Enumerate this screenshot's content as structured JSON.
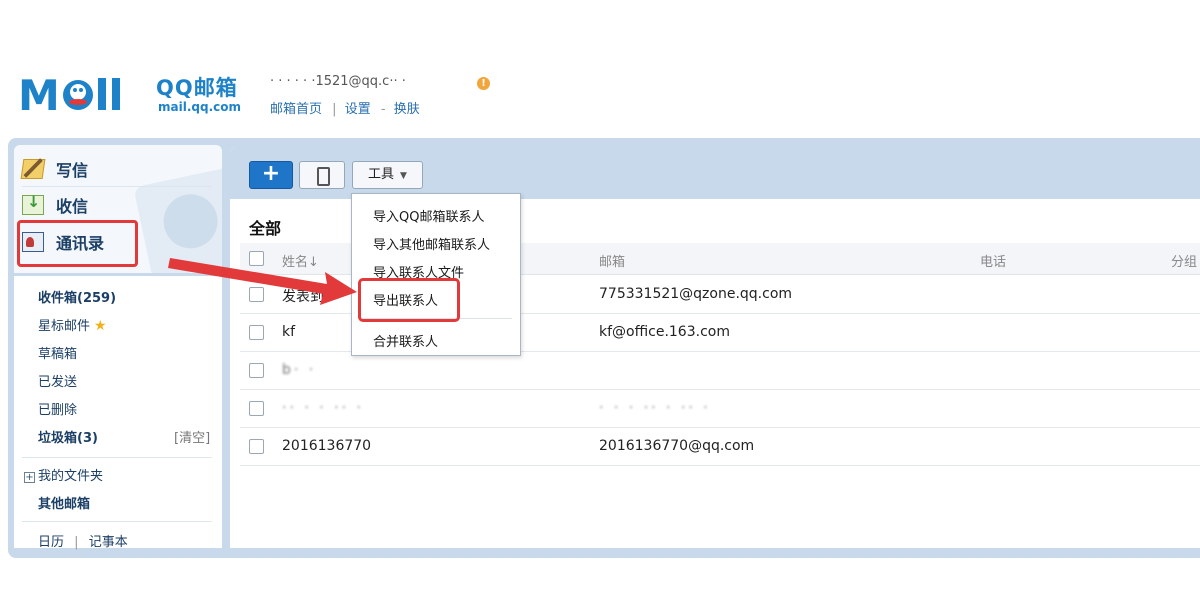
{
  "brand": {
    "logo_text": "MOil",
    "product_name": "QQ邮箱",
    "domain": "mail.qq.com"
  },
  "account": {
    "email_partial": "· ·  ·   · · ·1521@qq.c·· ·",
    "warning_icon": "warning-dot-icon"
  },
  "header_links": {
    "home": "邮箱首页",
    "separator": "|",
    "settings": "设置",
    "dash": "-",
    "skin": "换肤"
  },
  "sidebar": {
    "actions": [
      {
        "label": "写信",
        "icon": "write-icon"
      },
      {
        "label": "收信",
        "icon": "inbox-download-icon"
      },
      {
        "label": "通讯录",
        "icon": "contacts-card-icon"
      }
    ],
    "folders": [
      {
        "label": "收件箱(259)",
        "bold": true
      },
      {
        "label": "星标邮件",
        "icon": "star-icon"
      },
      {
        "label": "草稿箱"
      },
      {
        "label": "已发送"
      },
      {
        "label": "已删除"
      },
      {
        "label": "垃圾箱(3)",
        "bold": true,
        "action": "[清空]"
      }
    ],
    "my_folders": "我的文件夹",
    "my_folders_toggle": "+",
    "other_mailboxes": "其他邮箱",
    "calendar": "日历",
    "bottom_sep": "|",
    "notes": "记事本",
    "star_glyph": "★"
  },
  "toolbar": {
    "add_label": "+",
    "tools_label": "工具",
    "tools_caret": "▼"
  },
  "main": {
    "section_title": "全部",
    "columns": {
      "name": "姓名↓",
      "email": "邮箱",
      "phone": "电话",
      "group": "分组"
    },
    "rows": [
      {
        "name": "发表到",
        "name_blur": "·· ·",
        "email": "775331521@qzone.qq.com"
      },
      {
        "name": "kf",
        "email": "kf@office.163.com"
      },
      {
        "name": "",
        "name_blur": "b·   ·",
        "email": ""
      },
      {
        "name": "",
        "name_blur": "·· · · ·· ·",
        "email": "",
        "email_blur": "· · ·  ·· ·  ·· ·"
      },
      {
        "name": "2016136770",
        "email": "2016136770@qq.com"
      }
    ]
  },
  "tools_menu": {
    "items": [
      "导入QQ邮箱联系人",
      "导入其他邮箱联系人",
      "导入联系人文件",
      "导出联系人",
      "合并联系人"
    ]
  },
  "colors": {
    "brand_blue": "#1e82c8",
    "frame_blue": "#c8d9ec",
    "annotation_red": "#e23a3a",
    "add_button": "#1f76c8"
  }
}
